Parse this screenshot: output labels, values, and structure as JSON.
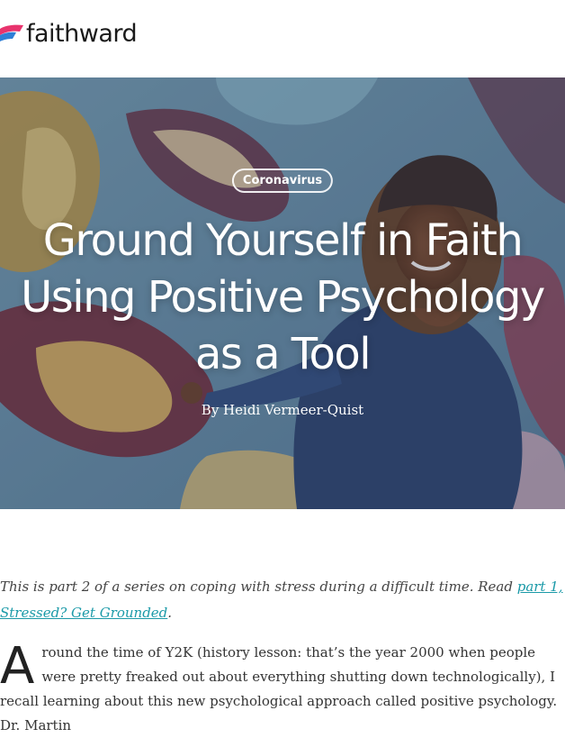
{
  "brand": {
    "name": "faithward",
    "colors": {
      "accent_teal": "#1b9aa8",
      "logo_pink": "#e8336d",
      "logo_blue": "#2e7fd6"
    }
  },
  "hero": {
    "category": "Coronavirus",
    "title": "Ground Yourself in Faith Using Positive Psychology as a Tool",
    "byline": "By Heidi Vermeer-Quist"
  },
  "article": {
    "intro_text": "This is part 2 of a series on coping with stress during a difficult time. Read ",
    "intro_link": "part 1, Stressed? Get Grounded",
    "intro_end": ".",
    "dropcap": "A",
    "first_para": "round the time of Y2K (history lesson: that’s the year 2000 when people were pretty freaked out about everything shutting down technologically), I recall learning about this new psychological approach called positive psychology. Dr. Martin"
  }
}
